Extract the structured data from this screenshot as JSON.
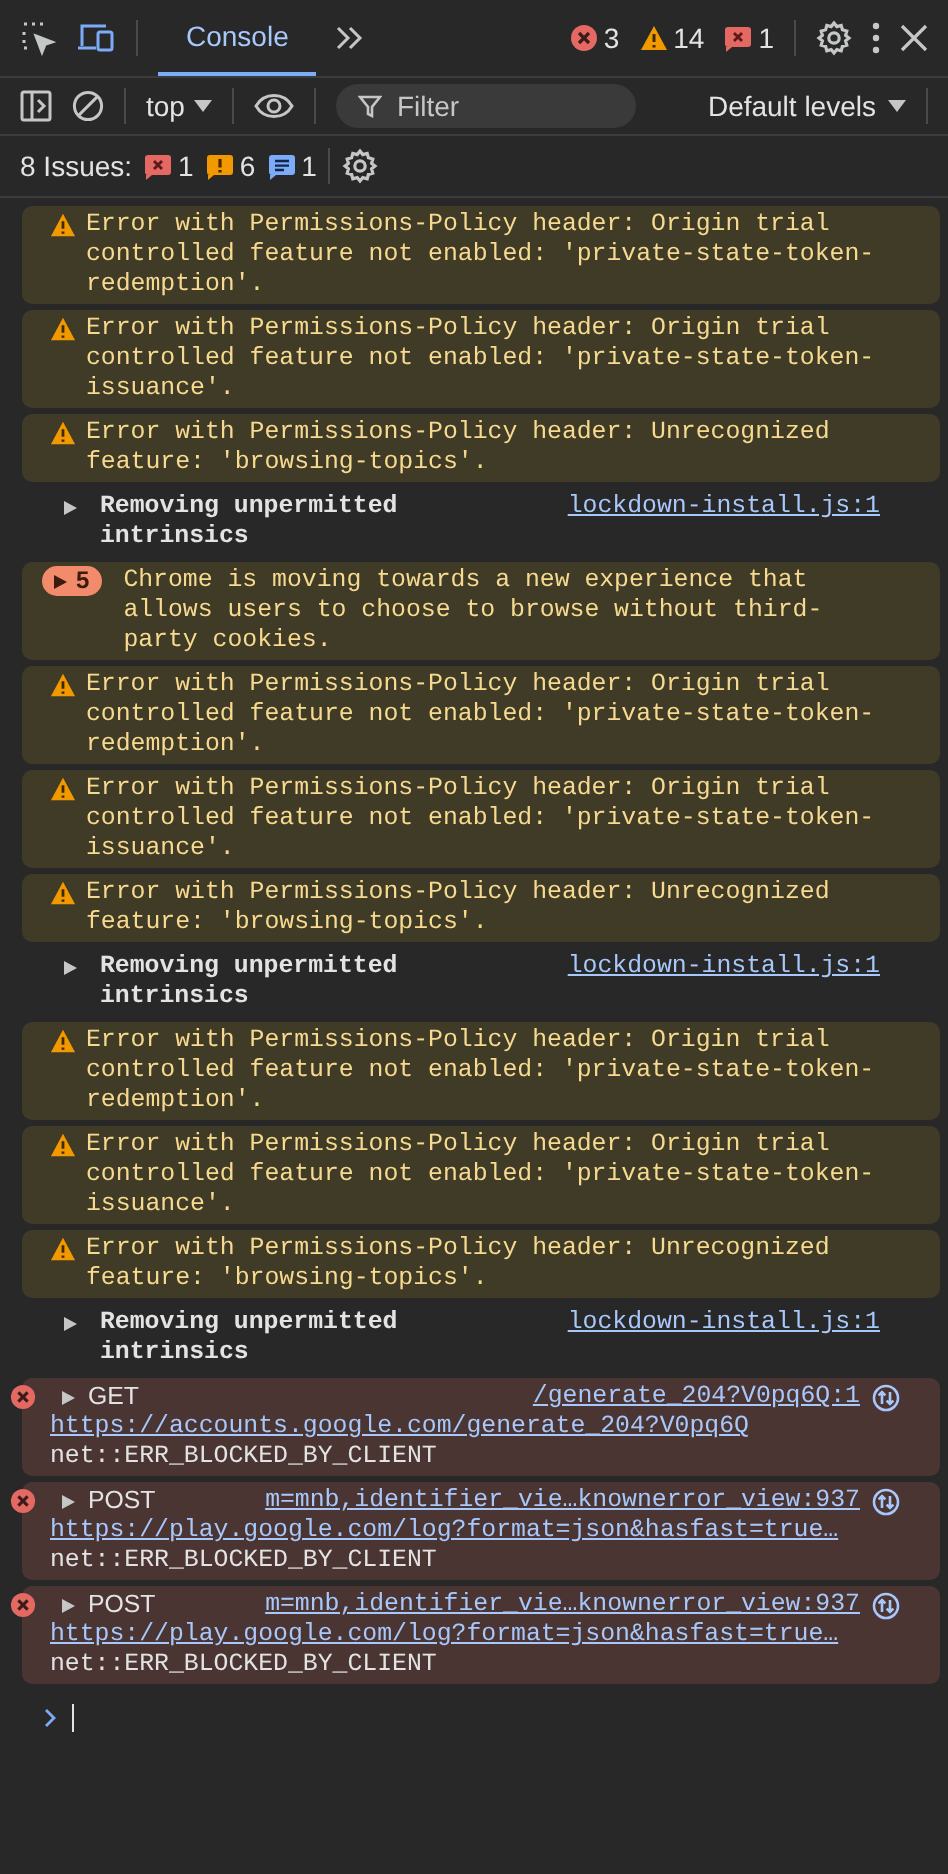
{
  "toolbar": {
    "tabs": [
      {
        "label": "Console",
        "selected": true
      }
    ],
    "counts": [
      {
        "kind": "error",
        "count": "3"
      },
      {
        "kind": "warning",
        "count": "14"
      },
      {
        "kind": "issue",
        "count": "1"
      }
    ]
  },
  "filter_bar": {
    "context": "top",
    "filter": {
      "placeholder": "Filter"
    },
    "levels": "Default levels"
  },
  "issues_bar": {
    "label": "8 Issues:",
    "counts": [
      {
        "kind": "error",
        "count": "1"
      },
      {
        "kind": "warning",
        "count": "6"
      },
      {
        "kind": "info",
        "count": "1"
      }
    ]
  },
  "messages": [
    {
      "kind": "warning",
      "text": "Error with Permissions-Policy header: Origin trial controlled feature not enabled: 'private-state-token-redemption'."
    },
    {
      "kind": "warning",
      "text": "Error with Permissions-Policy header: Origin trial controlled feature not enabled: 'private-state-token-issuance'."
    },
    {
      "kind": "warning",
      "text": "Error with Permissions-Policy header: Unrecognized feature: 'browsing-topics'."
    },
    {
      "kind": "log",
      "expanded": false,
      "text": "Removing unpermitted intrinsics",
      "source": "lockdown-install.js:1"
    },
    {
      "kind": "group",
      "count": "5",
      "text": "Chrome is moving towards a new experience that allows users to choose to browse without third-party cookies."
    },
    {
      "kind": "warning",
      "text": "Error with Permissions-Policy header: Origin trial controlled feature not enabled: 'private-state-token-redemption'."
    },
    {
      "kind": "warning",
      "text": "Error with Permissions-Policy header: Origin trial controlled feature not enabled: 'private-state-token-issuance'."
    },
    {
      "kind": "warning",
      "text": "Error with Permissions-Policy header: Unrecognized feature: 'browsing-topics'."
    },
    {
      "kind": "log",
      "expanded": false,
      "text": "Removing unpermitted intrinsics",
      "source": "lockdown-install.js:1"
    },
    {
      "kind": "warning",
      "text": "Error with Permissions-Policy header: Origin trial controlled feature not enabled: 'private-state-token-redemption'."
    },
    {
      "kind": "warning",
      "text": "Error with Permissions-Policy header: Origin trial controlled feature not enabled: 'private-state-token-issuance'."
    },
    {
      "kind": "warning",
      "text": "Error with Permissions-Policy header: Unrecognized feature: 'browsing-topics'."
    },
    {
      "kind": "log",
      "expanded": false,
      "text": "Removing unpermitted intrinsics",
      "source": "lockdown-install.js:1"
    },
    {
      "kind": "network",
      "expanded": false,
      "method": "GET",
      "source": "/generate_204?V0pq6Q:1",
      "url": "https://accounts.google.com/generate_204?V0pq6Q",
      "text": "net::ERR_BLOCKED_BY_CLIENT"
    },
    {
      "kind": "network",
      "expanded": false,
      "method": "POST",
      "source": "m=mnb,identifier_vie…knownerror_view:937",
      "url": "https://play.google.com/log?format=json&hasfast=true…",
      "text": "net::ERR_BLOCKED_BY_CLIENT"
    },
    {
      "kind": "network",
      "expanded": false,
      "method": "POST",
      "source": "m=mnb,identifier_vie…knownerror_view:937",
      "url": "https://play.google.com/log?format=json&hasfast=true…",
      "text": "net::ERR_BLOCKED_BY_CLIENT"
    }
  ]
}
